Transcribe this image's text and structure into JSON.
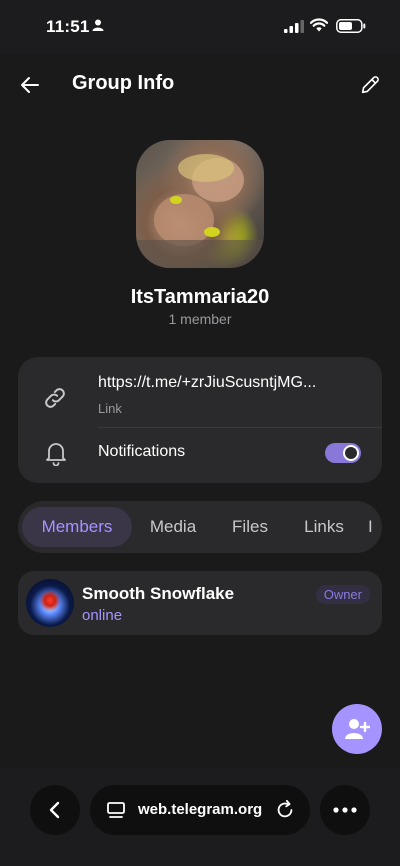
{
  "status_bar": {
    "time": "11:51"
  },
  "header": {
    "title": "Group Info"
  },
  "group": {
    "name": "ItsTammaria20",
    "member_count": "1 member"
  },
  "link": {
    "url": "https://t.me/+zrJiuScusntjMG...",
    "caption": "Link"
  },
  "notifications": {
    "label": "Notifications",
    "enabled": true
  },
  "tabs": [
    {
      "label": "Members",
      "active": true
    },
    {
      "label": "Media"
    },
    {
      "label": "Files"
    },
    {
      "label": "Links"
    },
    {
      "label": "I"
    }
  ],
  "members": [
    {
      "name": "Smooth Snowflake",
      "status": "online",
      "badge": "Owner"
    }
  ],
  "browser": {
    "url": "web.telegram.org"
  },
  "colors": {
    "accent": "#a594ff",
    "card": "#2a2a2c",
    "background": "#1a1a1a"
  },
  "icons": [
    "back-arrow-icon",
    "pencil-icon",
    "link-icon",
    "bell-icon",
    "add-member-icon",
    "chevron-left-icon",
    "tabs-icon",
    "reload-icon",
    "ellipsis-icon"
  ]
}
